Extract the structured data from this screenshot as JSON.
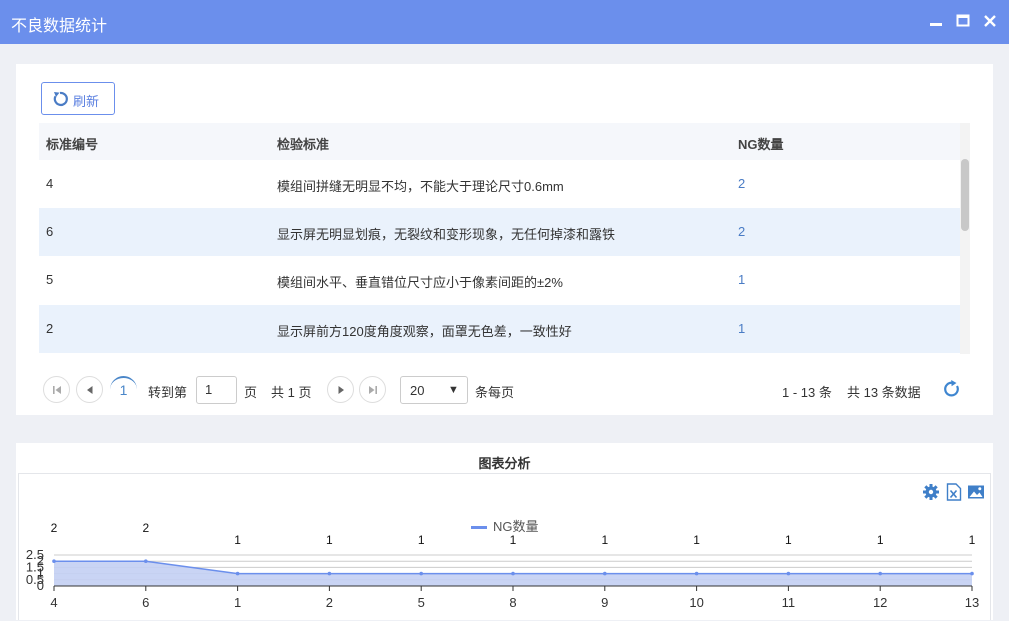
{
  "window": {
    "title": "不良数据统计"
  },
  "toolbar": {
    "refresh_label": "刷新"
  },
  "table": {
    "headers": [
      "标准编号",
      "检验标准",
      "NG数量"
    ],
    "rows": [
      [
        "4",
        "模组间拼缝无明显不均，不能大于理论尺寸0.6mm",
        "2"
      ],
      [
        "6",
        "显示屏无明显划痕，无裂纹和变形现象，无任何掉漆和露铁",
        "2"
      ],
      [
        "5",
        "模组间水平、垂直错位尺寸应小于像素间距的±2%",
        "1"
      ],
      [
        "2",
        "显示屏前方120度角度观察，面罩无色差，一致性好",
        "1"
      ]
    ]
  },
  "pager": {
    "current_page": "1",
    "goto_label": "转到第",
    "goto_value": "1",
    "page_unit": "页",
    "total_pages": "共 1 页",
    "page_size": "20",
    "per_page_label": "条每页",
    "range": "1 - 13 条",
    "total": "共 13 条数据"
  },
  "chart_panel": {
    "title": "图表分析"
  },
  "chart_data": {
    "type": "area",
    "categories": [
      "4",
      "6",
      "1",
      "2",
      "5",
      "8",
      "9",
      "10",
      "11",
      "12",
      "13"
    ],
    "series": [
      {
        "name": "NG数量",
        "values": [
          2,
          2,
          1,
          1,
          1,
          1,
          1,
          1,
          1,
          1,
          1
        ]
      }
    ],
    "y_ticks": [
      "0",
      "0.5",
      "1",
      "1.5",
      "2",
      "2.5"
    ],
    "ylim": [
      0,
      2.5
    ],
    "grid": true,
    "legend": "top-center",
    "colors": {
      "line": "#6b8fec",
      "fill": "#c3cff3"
    }
  },
  "icons": {
    "minimize": "minimize-icon",
    "maximize": "maximize-icon",
    "close": "close-icon",
    "refresh": "refresh-icon",
    "first": "first-page-icon",
    "prev": "prev-page-icon",
    "next": "next-page-icon",
    "last": "last-page-icon",
    "reload": "reload-icon",
    "settings": "gear-icon",
    "excel": "excel-export-icon",
    "image": "image-export-icon"
  },
  "colors": {
    "accent": "#6b8fec",
    "row_alt": "#eaf2fc",
    "link": "#4a7cc5"
  }
}
